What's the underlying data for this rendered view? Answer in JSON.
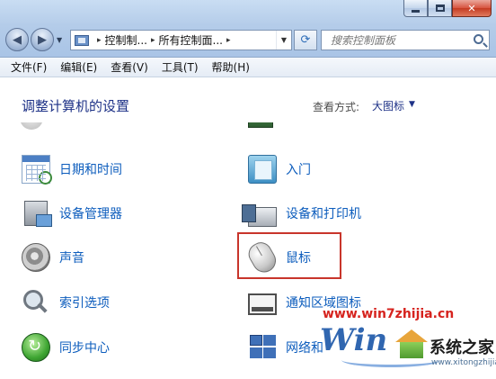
{
  "window": {
    "caption_buttons": {
      "minimize_icon": "minimize-icon",
      "maximize_icon": "maximize-icon",
      "close_glyph": "✕"
    }
  },
  "navigation": {
    "back_glyph": "◀",
    "forward_glyph": "▶",
    "dropdown_glyph": "▼",
    "refresh_glyph": "⟳"
  },
  "address_bar": {
    "separator": "▸",
    "crumbs": [
      "控制制...",
      "所有控制面...",
      ""
    ],
    "dropdown_glyph": "▼"
  },
  "search": {
    "placeholder": "搜索控制面板"
  },
  "menu": {
    "items": [
      "文件(F)",
      "编辑(E)",
      "查看(V)",
      "工具(T)",
      "帮助(H)"
    ]
  },
  "header": {
    "title": "调整计算机的设置",
    "view_label": "查看方式:",
    "view_value": "大图标",
    "view_caret": "▼"
  },
  "items": [
    {
      "label": "日期和时间",
      "icon": "calendar-clock-icon"
    },
    {
      "label": "入门",
      "icon": "getting-started-icon"
    },
    {
      "label": "设备管理器",
      "icon": "device-manager-icon"
    },
    {
      "label": "设备和打印机",
      "icon": "printer-icon"
    },
    {
      "label": "声音",
      "icon": "speaker-icon"
    },
    {
      "label": "鼠标",
      "icon": "mouse-icon",
      "highlighted": true,
      "highlight_color": "#c8352b"
    },
    {
      "label": "索引选项",
      "icon": "magnifier-icon"
    },
    {
      "label": "通知区域图标",
      "icon": "notification-area-icon"
    },
    {
      "label": "同步中心",
      "icon": "sync-center-icon"
    },
    {
      "label": "网络和",
      "icon": "network-icon"
    }
  ],
  "watermark": {
    "url": "www.win7zhijia.cn",
    "logo_text": "Win",
    "brand": "系统之家",
    "subtitle": "www.xitongzhijia.net"
  },
  "colors": {
    "link_text": "#0d5dbd",
    "title_text": "#1e3287",
    "highlight": "#c8352b",
    "watermark_red": "#d6231e"
  }
}
